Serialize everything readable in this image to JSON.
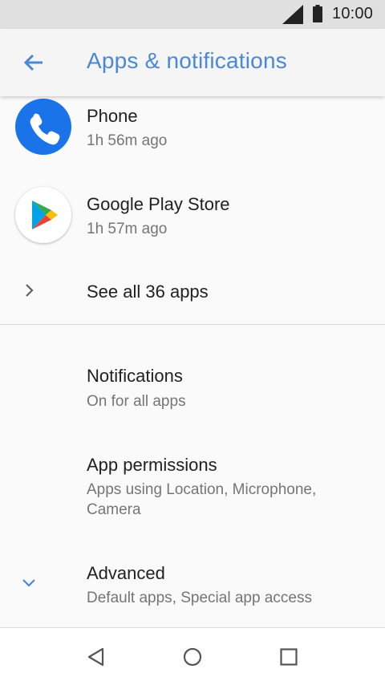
{
  "status_bar": {
    "time": "10:00",
    "signal_icon": "cell-signal-icon",
    "battery_icon": "battery-icon"
  },
  "app_bar": {
    "title": "Apps & notifications",
    "back_icon": "arrow-back-icon"
  },
  "recent_apps": [
    {
      "name": "Phone",
      "last_used": "1h 56m ago",
      "icon": "phone-app-icon"
    },
    {
      "name": "Google Play Store",
      "last_used": "1h 57m ago",
      "icon": "play-store-icon"
    }
  ],
  "see_all": {
    "label": "See all 36 apps",
    "icon": "chevron-right-icon"
  },
  "settings": [
    {
      "title": "Notifications",
      "summary": "On for all apps"
    },
    {
      "title": "App permissions",
      "summary_line1": "Apps using Location, Microphone,",
      "summary_line2": "Camera"
    },
    {
      "title": "Advanced",
      "summary": "Default apps, Special app access",
      "icon": "chevron-down-icon"
    }
  ],
  "nav_bar": {
    "back": "nav-back-icon",
    "home": "nav-home-icon",
    "recents": "nav-recents-icon"
  },
  "colors": {
    "accent": "#4a88d8",
    "phone_icon_bg": "#1a73e8",
    "text_primary": "#212121",
    "text_secondary": "#757575"
  }
}
